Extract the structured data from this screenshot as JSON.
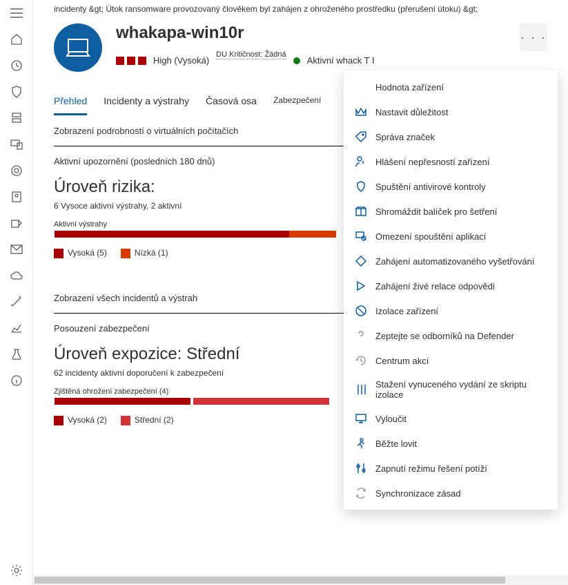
{
  "breadcrumb": "incidenty &gt;    Útok ransomware provozovaný člověkem byl zahájen z ohroženého prostředku (přerušení útoku) &gt;",
  "device": {
    "name": "whakapa-win10r",
    "risk_label": "High (Vysoká)",
    "criticality_prefix": "DU",
    "criticality": "Kritičnost: Žádná",
    "status": "Aktivní whack T I"
  },
  "tabs": {
    "t0": "Přehled",
    "t1": "Incidenty a výstrahy",
    "t2": "Časová osa",
    "t3": "Zabezpečení"
  },
  "sections": {
    "vm_details": "Zobrazení podrobností o virtuálních počítačích",
    "active_alerts_head": "Aktivní upozornění (posledních 180 dnů)",
    "risk_title": "Úroveň rizika:",
    "risk_sub": "6 Vysoce aktivní výstrahy, 2 aktivní",
    "bar1_label": "Aktivní výstrahy",
    "legend1_a": "Vysoká (5)",
    "legend1_b": "Nízká (1)",
    "view_all": "Zobrazení všech incidentů a výstrah",
    "sec_assessment": "Posouzení zabezpečení",
    "exposure_title": "Úroveň expozice: Střední",
    "exposure_sub": "62 incidenty aktivní doporučení k zabezpečení",
    "bar2_label": "Zjištěná ohrožení zabezpečení (4)",
    "legend2_a": "Vysoká (2)",
    "legend2_b": "Střední (2)"
  },
  "menu": {
    "m0": "Hodnota zařízení",
    "m1": "Nastavit důležitost",
    "m2": "Správa značek",
    "m3": "Hlášení nepřesností zařízení",
    "m4": "Spuštění antivirové kontroly",
    "m5": "Shromáždit balíček pro šetření",
    "m6": "Omezení spouštění aplikací",
    "m7": "Zahájení automatizovaného vyšetřování",
    "m8": "Zahájení živé relace odpovědi",
    "m9": "Izolace zařízení",
    "m10": "Zeptejte se odborníků na Defender",
    "m11": "Centrum akcí",
    "m12": "Stažení vynuceného vydání ze skriptu izolace",
    "m13": "Vyloučit",
    "m14": "Běžte lovit",
    "m15": "Zapnutí režimu řešení potíží",
    "m16": "Synchronizace zásad"
  },
  "chart_data": [
    {
      "type": "bar",
      "title": "Aktivní výstrahy",
      "series": [
        {
          "name": "Vysoká",
          "values": [
            5
          ]
        },
        {
          "name": "Nízká",
          "values": [
            1
          ]
        }
      ]
    },
    {
      "type": "bar",
      "title": "Zjištěná ohrožení zabezpečení (4)",
      "series": [
        {
          "name": "Vysoká",
          "values": [
            2
          ]
        },
        {
          "name": "Střední",
          "values": [
            2
          ]
        }
      ]
    }
  ]
}
